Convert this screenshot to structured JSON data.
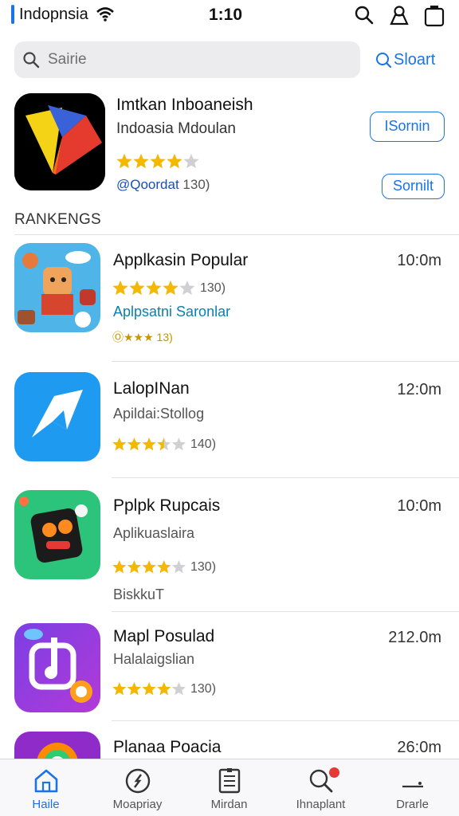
{
  "status_bar": {
    "carrier": "Indopnsia",
    "time": "1:10"
  },
  "search": {
    "placeholder": "Sairie",
    "button_label": "Sloart"
  },
  "featured": {
    "title": "Imtkan Inboaneish",
    "subtitle": "Indoasia Mdoulan",
    "rating": 4,
    "review_label": "@Qoordat",
    "review_count": "130)",
    "primary_button": "ISornin",
    "secondary_button": "Sornilt"
  },
  "section_title": "RANKENGS",
  "rankings": [
    {
      "name": "Applkasin Popular",
      "time": "10:0m",
      "rating": 4,
      "count": "130)",
      "subtitle": "Aplpsatni Saronlar",
      "small_review": "Ⓞ★★★ 13)"
    },
    {
      "name": "LalopINan",
      "time": "12:0m",
      "subtitle": "Apildai:Stollog",
      "rating": 3.5,
      "count": "140)"
    },
    {
      "name": "Pplpk Rupcais",
      "time": "10:0m",
      "subtitle": "Aplikuaslaira",
      "rating": 4,
      "count": "130)",
      "extra": "BiskkuT"
    },
    {
      "name": "Mapl Posulad",
      "time": "212.0m",
      "subtitle": "Halalaigslian",
      "rating": 4,
      "count": "130)"
    },
    {
      "name": "Planaa Poacia",
      "time": "26:0m"
    }
  ],
  "tabs": [
    {
      "label": "Haile",
      "icon": "home-icon",
      "active": true
    },
    {
      "label": "Moapriay",
      "icon": "compass-icon",
      "active": false
    },
    {
      "label": "Mirdan",
      "icon": "document-icon",
      "active": false
    },
    {
      "label": "Ihnaplant",
      "icon": "search-icon",
      "active": false
    },
    {
      "label": "Drarle",
      "icon": "more-icon",
      "active": false
    }
  ],
  "colors": {
    "accent": "#1a73e8",
    "star": "#f5b800",
    "star_empty": "#d0d0d4"
  }
}
